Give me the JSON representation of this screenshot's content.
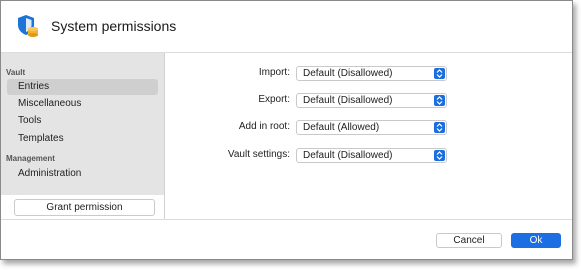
{
  "window": {
    "title": "System permissions"
  },
  "sidebar": {
    "sections": [
      {
        "label": "Vault",
        "items": [
          "Entries",
          "Miscellaneous",
          "Tools",
          "Templates"
        ]
      },
      {
        "label": "Management",
        "items": [
          "Administration"
        ]
      }
    ],
    "selected_item": "Entries",
    "grant_button": "Grant permission"
  },
  "form": {
    "fields": [
      {
        "label": "Import:",
        "value": "Default (Disallowed)"
      },
      {
        "label": "Export:",
        "value": "Default (Disallowed)"
      },
      {
        "label": "Add in root:",
        "value": "Default (Allowed)"
      },
      {
        "label": "Vault settings:",
        "value": "Default (Disallowed)"
      }
    ]
  },
  "footer": {
    "cancel_label": "Cancel",
    "ok_label": "Ok"
  },
  "colors": {
    "accent": "#1b6fe3",
    "sidebar_bg": "#e4e4e4",
    "selected_bg": "#cfcfcf"
  },
  "icons": {
    "app": "shield-database-icon",
    "select": "updown-chevron-icon"
  }
}
